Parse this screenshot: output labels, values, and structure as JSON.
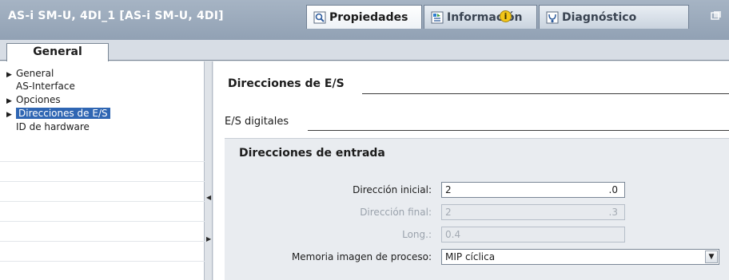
{
  "window": {
    "title": "AS-i SM-U, 4DI_1 [AS-i SM-U, 4DI]",
    "tabs": [
      {
        "label": "Propiedades",
        "icon": "properties-icon",
        "active": true
      },
      {
        "label": "Información",
        "icon": "info-tab-icon",
        "active": false
      },
      {
        "label": "Diagnóstico",
        "icon": "diagnostics-icon",
        "active": false
      }
    ],
    "info_badge": "i"
  },
  "general_tab": {
    "label": "General"
  },
  "nav": {
    "items": [
      {
        "label": "General",
        "expandable": true,
        "selected": false
      },
      {
        "label": "AS-Interface",
        "expandable": false,
        "selected": false
      },
      {
        "label": "Opciones",
        "expandable": true,
        "selected": false
      },
      {
        "label": "Direcciones de E/S",
        "expandable": true,
        "selected": true
      },
      {
        "label": "ID de hardware",
        "expandable": false,
        "selected": false
      }
    ]
  },
  "content": {
    "section_title": "Direcciones de E/S",
    "subsection_title": "E/S digitales",
    "panel": {
      "title": "Direcciones de entrada",
      "fields": [
        {
          "label": "Dirección inicial:",
          "value": "2",
          "suffix": ".0",
          "disabled": false
        },
        {
          "label": "Dirección final:",
          "value": "2",
          "suffix": ".3",
          "disabled": true
        },
        {
          "label": "Long.:",
          "value": "0.4",
          "suffix": "",
          "disabled": true
        },
        {
          "label": "Memoria imagen de proceso:",
          "value": "MIP cíclica",
          "dropdown": true,
          "disabled": false
        }
      ]
    }
  },
  "colors": {
    "titlebar": "#9aa9bb",
    "selection": "#2f66b3",
    "panel_bg": "#e9ecf0"
  }
}
